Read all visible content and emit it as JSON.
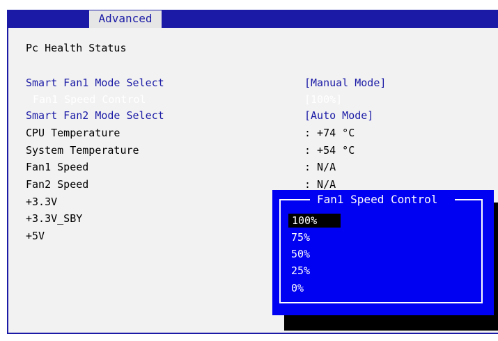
{
  "tabs": {
    "active": "Advanced"
  },
  "section_title": "Pc Health Status",
  "settings": [
    {
      "label": "Smart Fan1 Mode Select",
      "value": "[Manual Mode]"
    },
    {
      "label": "Fan1 Speed Control",
      "value": "[100%]"
    },
    {
      "label": "Smart Fan2 Mode Select",
      "value": "[Auto Mode]"
    },
    {
      "label": "CPU Temperature",
      "value": ": +74 °C"
    },
    {
      "label": "System Temperature",
      "value": ": +54 °C"
    },
    {
      "label": "Fan1 Speed",
      "value": ": N/A"
    },
    {
      "label": "Fan2 Speed",
      "value": ": N/A"
    },
    {
      "label": "+3.3V",
      "value": ""
    },
    {
      "label": "+3.3V_SBY",
      "value": ""
    },
    {
      "label": "+5V",
      "value": ""
    }
  ],
  "popup": {
    "title": "Fan1 Speed Control",
    "options": [
      "100%",
      "75%",
      "50%",
      "25%",
      "0%"
    ],
    "selected": "100%"
  },
  "colors": {
    "bios_blue": "#1a1aa6",
    "popup_blue": "#0000f2",
    "panel_bg": "#f2f2f2"
  }
}
